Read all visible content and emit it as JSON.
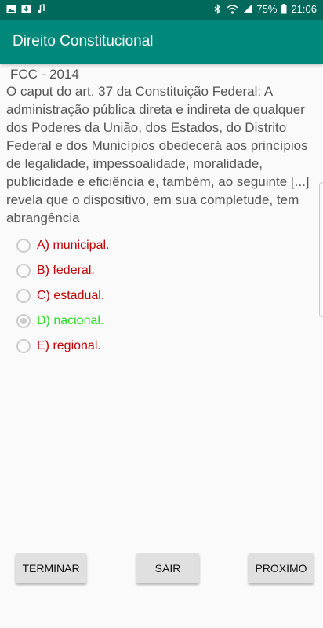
{
  "status_bar": {
    "battery": "75%",
    "time": "21:06"
  },
  "app_bar": {
    "title": "Direito Constitucional"
  },
  "question": {
    "exam": "FCC - 2014",
    "text": "O caput do art. 37 da Constituição Federal: A administração pública direta e indireta de qualquer dos Poderes da União, dos Estados, do Distrito Federal e dos Municípios obedecerá aos princípios de legalidade, impessoalidade, moralidade, publicidade e eficiência e, também, ao seguinte [...] revela que o dispositivo, em sua completude, tem abrangência"
  },
  "options": [
    {
      "label": "A) municipal.",
      "checked": false,
      "color": "#c00000"
    },
    {
      "label": "B) federal.",
      "checked": false,
      "color": "#c00000"
    },
    {
      "label": "C) estadual.",
      "checked": false,
      "color": "#c00000"
    },
    {
      "label": "D) nacional.",
      "checked": true,
      "color": "#22dd22"
    },
    {
      "label": "E) regional.",
      "checked": false,
      "color": "#c00000"
    }
  ],
  "buttons": {
    "terminar": "TERMINAR",
    "sair": "SAIR",
    "proximo": "PROXIMO"
  },
  "colors": {
    "status_bar": "#00695c",
    "app_bar": "#00897b",
    "wrong": "#c00000",
    "correct": "#22dd22"
  },
  "icons": [
    "image-icon",
    "download-icon",
    "music-note-icon",
    "bluetooth-icon",
    "wifi-icon",
    "signal-icon",
    "battery-icon"
  ]
}
